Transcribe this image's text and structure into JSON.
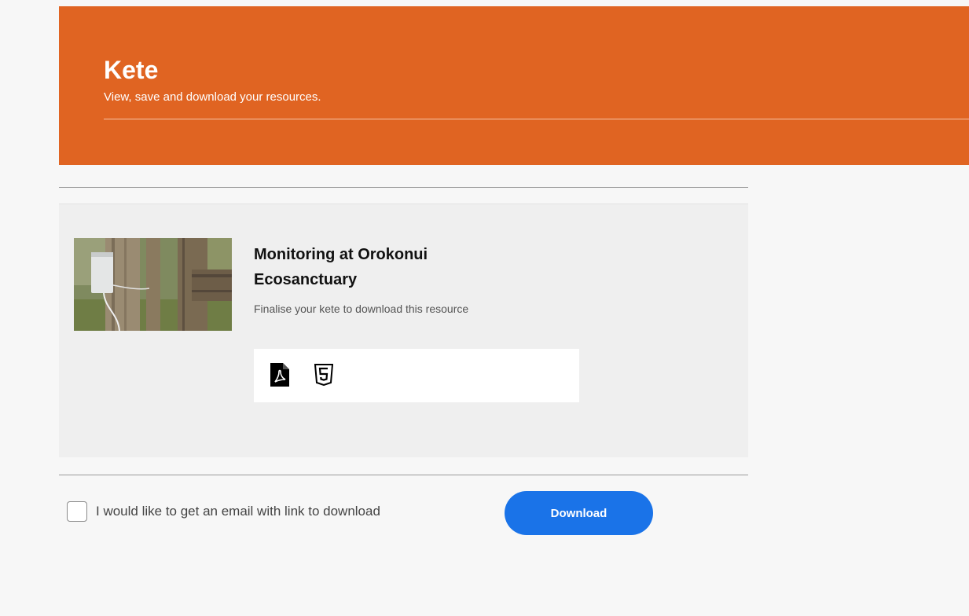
{
  "header": {
    "title": "Kete",
    "subtitle": "View, save and download your resources.",
    "background_color": "#e06422"
  },
  "resource": {
    "title": "Monitoring at Orokonui Ecosanctuary",
    "note": "Finalise your kete to download this resource",
    "thumbnail_icon": "photo-thumbnail",
    "formats": [
      {
        "icon": "pdf-file-icon"
      },
      {
        "icon": "html5-icon"
      }
    ]
  },
  "email_option": {
    "label": "I would like to get an email with link to download",
    "checked": false
  },
  "download_button": {
    "label": "Download",
    "color": "#1a73e8"
  }
}
